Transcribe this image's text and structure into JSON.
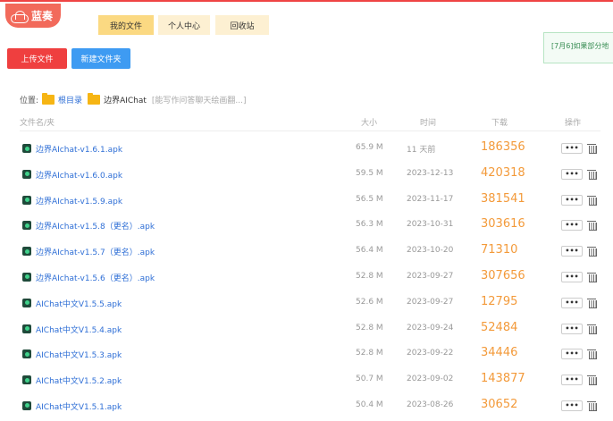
{
  "brand": {
    "name": "蓝奏"
  },
  "nav": {
    "my_files": "我的文件",
    "user_center": "个人中心",
    "recycle_bin": "回收站"
  },
  "tip": {
    "text": "[7月6]如果部分地"
  },
  "toolbar": {
    "upload_label": "上传文件",
    "new_folder_label": "新建文件夹"
  },
  "path": {
    "label": "位置:",
    "root": "根目录",
    "current": "边界AIChat",
    "note": "[能写作问答聊天绘画翻...]"
  },
  "table": {
    "headers": {
      "name": "文件名/夹",
      "size": "大小",
      "time": "时间",
      "downloads": "下载",
      "actions": "操作"
    },
    "more_label": "•••",
    "rows": [
      {
        "name": "边界AIchat-v1.6.1.apk",
        "size": "65.9 M",
        "time": "11 天前",
        "downloads": "186356"
      },
      {
        "name": "边界AIchat-v1.6.0.apk",
        "size": "59.5 M",
        "time": "2023-12-13",
        "downloads": "420318"
      },
      {
        "name": "边界AIchat-v1.5.9.apk",
        "size": "56.5 M",
        "time": "2023-11-17",
        "downloads": "381541"
      },
      {
        "name": "边界AIchat-v1.5.8（更名）.apk",
        "size": "56.3 M",
        "time": "2023-10-31",
        "downloads": "303616"
      },
      {
        "name": "边界AIchat-v1.5.7（更名）.apk",
        "size": "56.4 M",
        "time": "2023-10-20",
        "downloads": "71310"
      },
      {
        "name": "边界AIchat-v1.5.6（更名）.apk",
        "size": "52.8 M",
        "time": "2023-09-27",
        "downloads": "307656"
      },
      {
        "name": "AIChat中文V1.5.5.apk",
        "size": "52.6 M",
        "time": "2023-09-27",
        "downloads": "12795"
      },
      {
        "name": "AIChat中文V1.5.4.apk",
        "size": "52.8 M",
        "time": "2023-09-24",
        "downloads": "52484"
      },
      {
        "name": "AIChat中文V1.5.3.apk",
        "size": "52.8 M",
        "time": "2023-09-22",
        "downloads": "34446"
      },
      {
        "name": "AIChat中文V1.5.2.apk",
        "size": "50.7 M",
        "time": "2023-09-02",
        "downloads": "143877"
      },
      {
        "name": "AIChat中文V1.5.1.apk",
        "size": "50.4 M",
        "time": "2023-08-26",
        "downloads": "30652"
      }
    ]
  }
}
